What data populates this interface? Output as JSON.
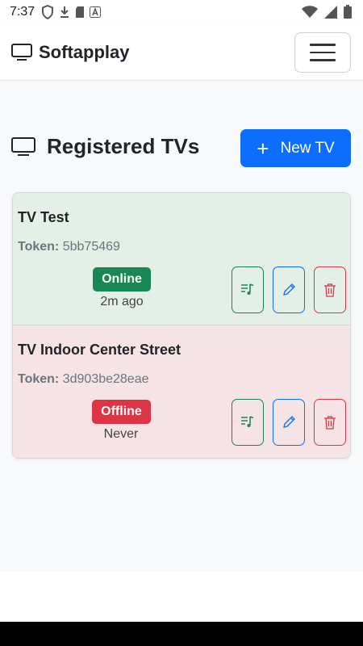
{
  "status_bar": {
    "time": "7:37"
  },
  "navbar": {
    "brand": "Softapplay"
  },
  "page": {
    "title": "Registered TVs",
    "new_button_label": "New TV"
  },
  "tvs": [
    {
      "name": "TV Test",
      "token_label": "Token:",
      "token": "5bb75469",
      "status": "Online",
      "last_seen": "2m ago"
    },
    {
      "name": "TV Indoor Center Street",
      "token_label": "Token:",
      "token": "3d903be28eae",
      "status": "Offline",
      "last_seen": "Never"
    }
  ],
  "colors": {
    "primary": "#0d6efd",
    "success": "#198754",
    "danger": "#dc3545",
    "online_bg": "#e3efe7",
    "offline_bg": "#f5e3e5"
  },
  "icons": [
    "tv-icon",
    "menu-icon",
    "plus-icon",
    "playlist-icon",
    "pencil-icon",
    "trash-icon"
  ]
}
